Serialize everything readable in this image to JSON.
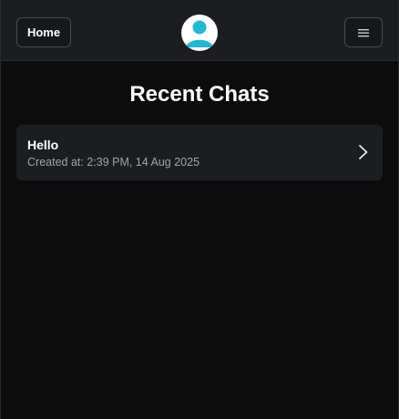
{
  "header": {
    "home_label": "Home",
    "avatar_icon": "user-avatar-icon",
    "menu_icon": "hamburger-menu-icon"
  },
  "main": {
    "title": "Recent Chats",
    "chats": [
      {
        "title": "Hello",
        "meta": "Created at: 2:39 PM, 14 Aug 2025",
        "icon": "chevron-right-icon"
      }
    ]
  },
  "colors": {
    "background": "#0c0c0d",
    "surface": "#1c1d21",
    "avatar_accent": "#27b6cf",
    "text": "#ffffff",
    "muted_text": "#a3a4ab"
  }
}
